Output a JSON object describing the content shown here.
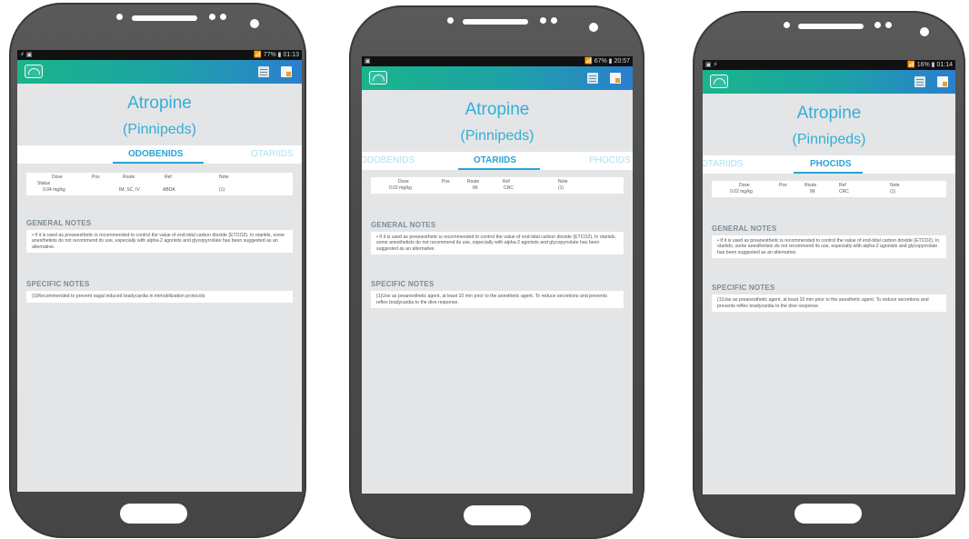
{
  "phones": [
    {
      "status_left": "⚡ ▣",
      "status_right": "📶 77% ▮ 01:13",
      "title": "Atropine",
      "subtitle": "(Pinnipeds)",
      "tabs": [
        "ODOBENIDS",
        "OTARIIDS"
      ],
      "active_tab": "ODOBENIDS",
      "dose_headers": [
        "Dose",
        "Pos",
        "Route",
        "Ref",
        "Note"
      ],
      "dose_headers_extra": "Status",
      "dose_values": [
        "0.04 mg/kg",
        "",
        "IM, SC, IV",
        "ABDA",
        "(1)"
      ],
      "general_notes_label": "GENERAL NOTES",
      "general_notes_text": "• If it is used as preanesthetic is recommended to control the value of end-tidal carbon dioxide (ETCO2). In otariids, some anesthetists do not recommend its use, especially with alpha-2 agonists and glycopyrrolate has been suggested as an alternative.",
      "specific_notes_label": "SPECIFIC NOTES",
      "specific_notes_text": "(1)Recommended to prevent vagal induced bradycardia in immobilization protocols"
    },
    {
      "status_left": "▣",
      "status_right": "📶 67% ▮ 20:57",
      "title": "Atropine",
      "subtitle": "(Pinnipeds)",
      "tabs": [
        "ODOBENIDS",
        "OTARIIDS",
        "PHOCIDS"
      ],
      "active_tab": "OTARIIDS",
      "dose_headers": [
        "Dose",
        "Pos",
        "Route",
        "Ref",
        "Note"
      ],
      "dose_headers_extra": "",
      "dose_values": [
        "0.02 mg/kg",
        "",
        "IM",
        "CRC",
        "(1)"
      ],
      "general_notes_label": "GENERAL NOTES",
      "general_notes_text": "• If it is used as preanesthetic is recommended to control the value of end-tidal carbon dioxide (ETCO2). In otariids, some anesthetists do not recommend its use, especially with alpha-2 agonists and glycopyrrolate has been suggested as an alternative.",
      "specific_notes_label": "SPECIFIC NOTES",
      "specific_notes_text": "(1)Use as preanesthetic agent, at least 10 min prior to the anesthetic agent. To reduce secretions and prevents reflex bradycardia to the dive response."
    },
    {
      "status_left": "▣ ⚡",
      "status_right": "📶 16% ▮ 01:14",
      "title": "Atropine",
      "subtitle": "(Pinnipeds)",
      "tabs": [
        "OTARIIDS",
        "PHOCIDS"
      ],
      "active_tab": "PHOCIDS",
      "dose_headers": [
        "Dose",
        "Pos",
        "Route",
        "Ref",
        "Note"
      ],
      "dose_headers_extra": "",
      "dose_values": [
        "0.02 mg/kg",
        "",
        "IM",
        "CRC",
        "(1)"
      ],
      "general_notes_label": "GENERAL NOTES",
      "general_notes_text": "• If it is used as preanesthetic is recommended to control the value of end-tidal carbon dioxide (ETCO2). In otariids, some anesthetists do not recommend its use, especially with alpha-2 agonists and glycopyrrolate has been suggested as an alternative.",
      "specific_notes_label": "SPECIFIC NOTES",
      "specific_notes_text": "(1)Use as preanesthetic agent, at least 10 min prior to the anesthetic agent. To reduce secretions and prevents reflex bradycardia to the dive response."
    }
  ],
  "colors": {
    "accent": "#2aa4d4",
    "appbar_start": "#19b58a",
    "appbar_end": "#2b7fcf",
    "phone_body": "#4d4d4d",
    "screen_bg": "#e4e5e6"
  },
  "icons": [
    "app-logo-icon",
    "list-icon",
    "edit-note-icon"
  ]
}
